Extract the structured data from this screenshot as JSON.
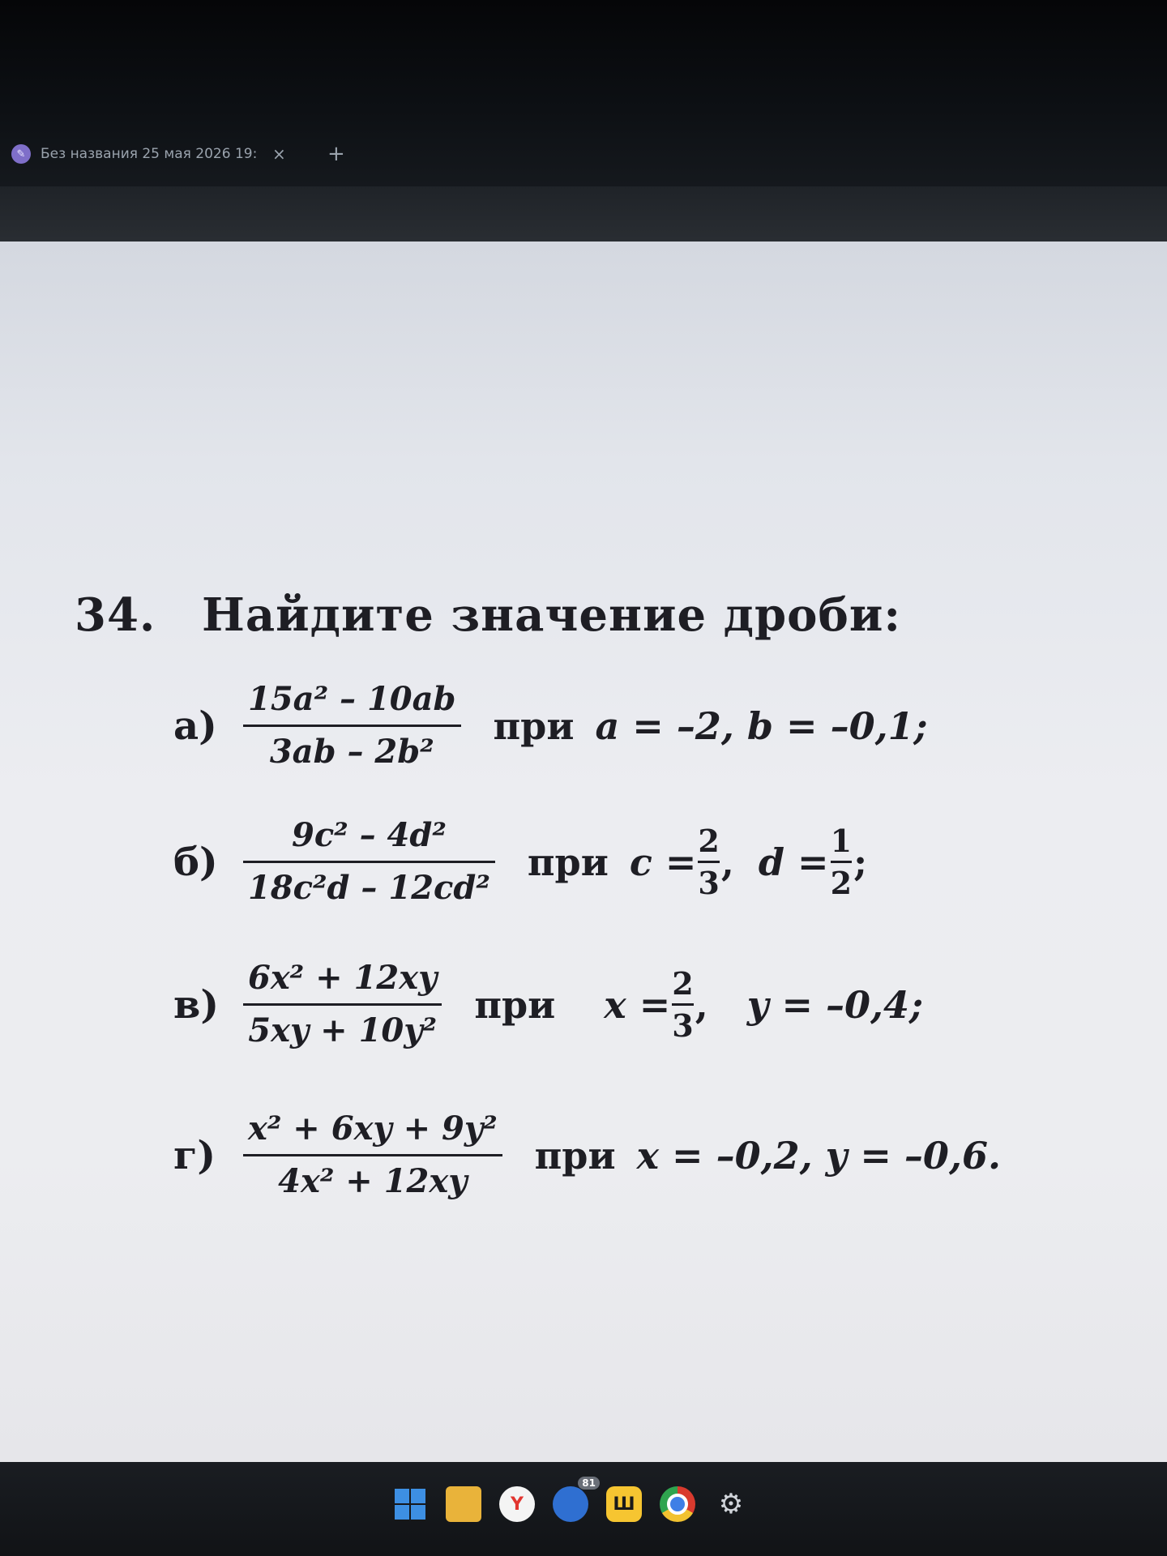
{
  "browser": {
    "tab_title": "Без названия 25 мая 2026 19:",
    "tab_icon": "doc-app-icon",
    "close_glyph": "×",
    "new_tab_glyph": "+"
  },
  "document": {
    "problem_number": "34.",
    "problem_title": "Найдите значение дроби:",
    "items": [
      {
        "label": "а)",
        "numerator": "15a² – 10ab",
        "denominator": "3ab – 2b²",
        "word": "при",
        "condition": "a = –2,  b = –0,1;"
      },
      {
        "label": "б)",
        "numerator": "9c² – 4d²",
        "denominator": "18c²d – 12cd²",
        "word": "при",
        "c_var": "c =",
        "c_num": "2",
        "c_den": "3",
        "sep": ",",
        "d_var": "d =",
        "d_num": "1",
        "d_den": "2",
        "end": ";"
      },
      {
        "label": "в)",
        "numerator": "6x² + 12xy",
        "denominator": "5xy + 10y²",
        "word": "при",
        "x_var": "x =",
        "x_num": "2",
        "x_den": "3",
        "sep": ",",
        "rest": "y = –0,4;"
      },
      {
        "label": "г)",
        "numerator": "x² + 6xy + 9y²",
        "denominator": "4x² + 12xy",
        "word": "при",
        "condition": "x = –0,2,  y = –0,6."
      }
    ]
  },
  "taskbar": {
    "icons": [
      "windows-start-icon",
      "file-explorer-icon",
      "yandex-browser-icon",
      "vpn-icon",
      "russian-app-icon",
      "chrome-icon",
      "settings-gear-icon"
    ],
    "yandex_glyph": "Y",
    "vpn_badge": "81",
    "rus_glyph": "Ш",
    "gear_glyph": "⚙"
  }
}
